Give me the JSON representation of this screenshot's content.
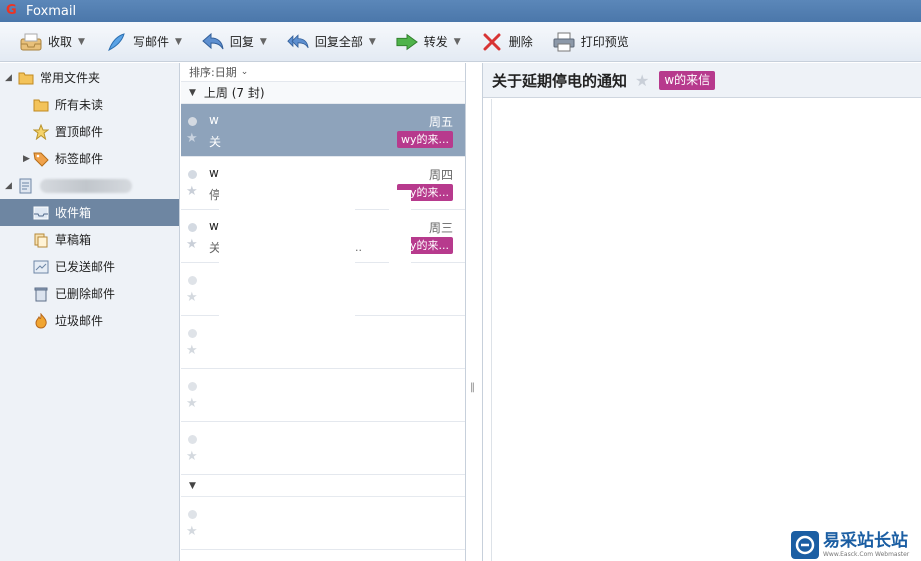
{
  "app": {
    "title": "Foxmail"
  },
  "toolbar": {
    "receive": "收取",
    "compose": "写邮件",
    "reply": "回复",
    "reply_all": "回复全部",
    "forward": "转发",
    "delete": "删除",
    "print_preview": "打印预览"
  },
  "sidebar": {
    "common_folders": "常用文件夹",
    "all_unread": "所有未读",
    "pinned": "置顶邮件",
    "tagged": "标签邮件",
    "inbox": "收件箱",
    "drafts": "草稿箱",
    "sent": "已发送邮件",
    "deleted": "已删除邮件",
    "junk": "垃圾邮件"
  },
  "list": {
    "sort_label": "排序:日期",
    "group_label": "上周 (7 封)",
    "messages": [
      {
        "sender": "w",
        "subject": "关",
        "day": "周五",
        "tag": "wy的来..."
      },
      {
        "sender": "w",
        "subject": "停",
        "day": "周四",
        "tag": "wy的来..."
      },
      {
        "sender": "w",
        "subject": "关",
        "day": "周三",
        "tag": "wy的来..."
      }
    ],
    "ellipsis": ".."
  },
  "reader": {
    "subject": "关于延期停电的通知",
    "tag": "w的来信"
  },
  "watermark": {
    "main": "易采站长站",
    "sub": "Www.Easck.Com Webmaster"
  },
  "colors": {
    "tag": "#b73a8d",
    "selection": "#6e86a2",
    "titlebar": "#5b87b9"
  }
}
